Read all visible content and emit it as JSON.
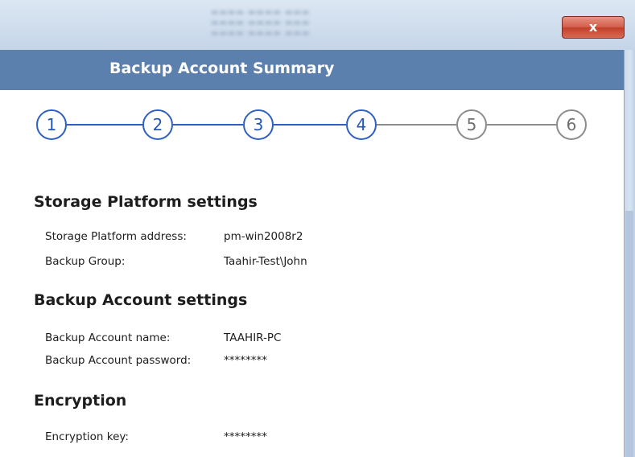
{
  "window": {
    "close_glyph": "x",
    "title": "Backup Account Summary"
  },
  "steps": [
    {
      "label": "1",
      "state": "active"
    },
    {
      "label": "2",
      "state": "active"
    },
    {
      "label": "3",
      "state": "active"
    },
    {
      "label": "4",
      "state": "active"
    },
    {
      "label": "5",
      "state": "inactive"
    },
    {
      "label": "6",
      "state": "inactive"
    }
  ],
  "sections": {
    "storage": {
      "title": "Storage Platform settings",
      "address_label": "Storage Platform address:",
      "address_value": "pm-win2008r2",
      "group_label": "Backup Group:",
      "group_value": "Taahir-Test\\John"
    },
    "account": {
      "title": "Backup Account settings",
      "name_label": "Backup Account name:",
      "name_value": "TAAHIR-PC",
      "password_label": "Backup Account password:",
      "password_value": "********"
    },
    "encryption": {
      "title": "Encryption",
      "key_label": "Encryption key:",
      "key_value": "********"
    }
  },
  "colors": {
    "header_band": "#5b80ad",
    "step_active": "#2f60c0",
    "step_inactive": "#8c8c8c",
    "close_button": "#c2402b"
  }
}
